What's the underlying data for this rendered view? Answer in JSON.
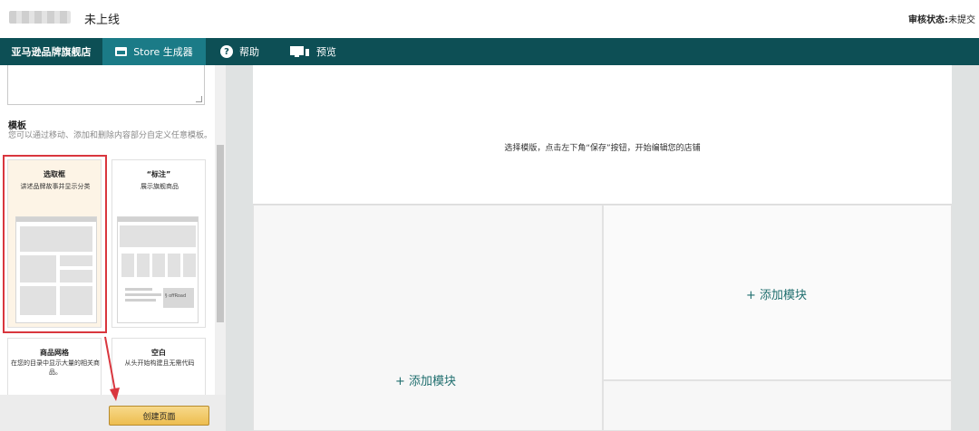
{
  "header": {
    "store_status": "未上线",
    "review_status_label": "审核状态:",
    "review_status_value": "未提交"
  },
  "nav": {
    "brand": "亚马逊品牌旗舰店",
    "items": [
      {
        "label": "Store 生成器",
        "icon": "store-icon",
        "active": true
      },
      {
        "label": "帮助",
        "icon": "help-icon"
      },
      {
        "label": "预览",
        "icon": "preview-icon"
      }
    ],
    "bar_color": "#0d4f55",
    "active_color": "#1b7b87"
  },
  "left_panel": {
    "templates_heading": "模板",
    "templates_desc": "您可以通过移动、添加和删除内容部分自定义任意模板。",
    "templates": [
      {
        "title": "选取框",
        "desc": "讲述品牌故事并显示分类",
        "selected": true
      },
      {
        "title": "“标注”",
        "desc": "展示旗舰商品",
        "thumb_badge": "§ offRoad"
      },
      {
        "title": "商品网格",
        "desc": "在您的目录中显示大量的相关商品。"
      },
      {
        "title": "空白",
        "desc": "从头开始构建且无需代码"
      }
    ],
    "create_button": "创建页面"
  },
  "canvas": {
    "banner_text": "选择模版，点击左下角“保存”按钮，开始编辑您的店铺",
    "add_module_a": "+ 添加模块",
    "add_module_b": "+ 添加模块"
  }
}
